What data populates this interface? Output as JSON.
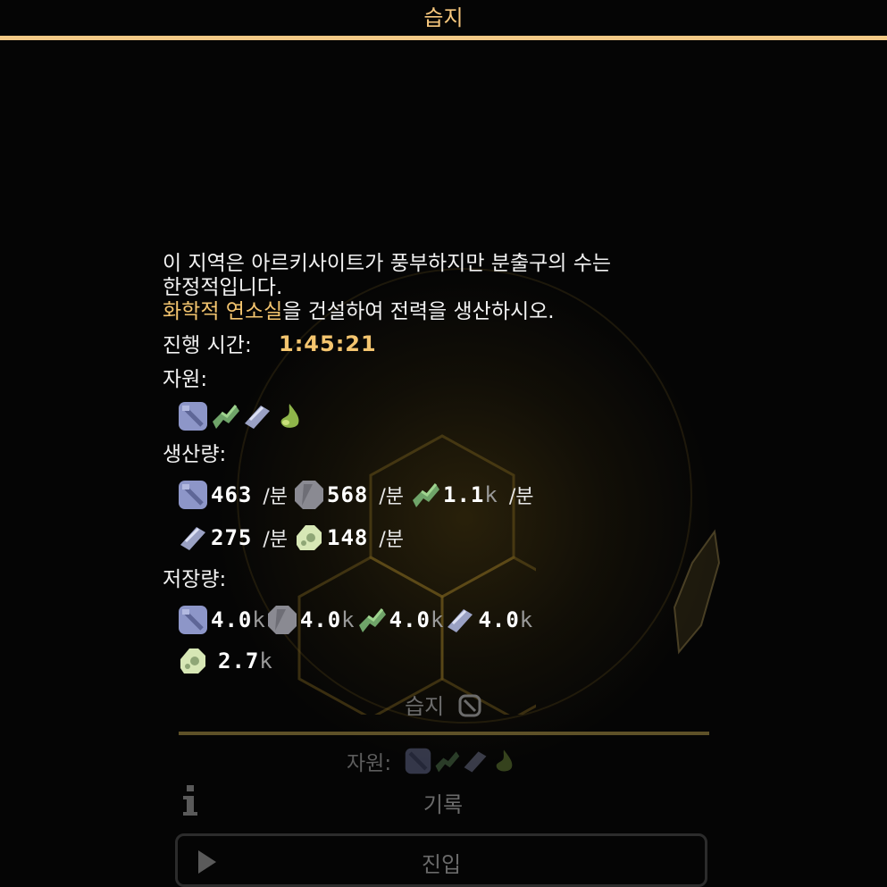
{
  "header": {
    "title": "습지"
  },
  "description": {
    "line1": "이 지역은 아르키사이트가 풍부하지만 분출구의 수는",
    "line2": "한정적입니다.",
    "highlight": "화학적 연소실",
    "rest": "을 건설하여 전력을 생산하시오."
  },
  "elapsed": {
    "label": "진행 시간:",
    "value": "1:45:21"
  },
  "resources": {
    "label": "자원:",
    "icons": [
      "beryllium-icon",
      "tungsten-icon",
      "graphite-icon",
      "arkycite-icon"
    ]
  },
  "production": {
    "label": "생산량:",
    "unit": "/분",
    "items": [
      {
        "icon": "beryllium-icon",
        "value": "463"
      },
      {
        "icon": "sand-icon",
        "value": "568"
      },
      {
        "icon": "tungsten-icon",
        "value": "1.1",
        "suffix": "k"
      },
      {
        "icon": "graphite-icon",
        "value": "275"
      },
      {
        "icon": "silicon-icon",
        "value": "148"
      }
    ]
  },
  "storage": {
    "label": "저장량:",
    "items": [
      {
        "icon": "beryllium-icon",
        "value": "4.0",
        "suffix": "k"
      },
      {
        "icon": "sand-icon",
        "value": "4.0",
        "suffix": "k"
      },
      {
        "icon": "tungsten-icon",
        "value": "4.0",
        "suffix": "k"
      },
      {
        "icon": "graphite-icon",
        "value": "4.0",
        "suffix": "k"
      },
      {
        "icon": "silicon-icon",
        "value": "2.7",
        "suffix": "k"
      }
    ]
  },
  "sector_panel": {
    "title": "습지",
    "resources_label": "자원:",
    "info_label": "기록",
    "enter_label": "진입"
  },
  "colors": {
    "accent": "#f3c985",
    "highlight": "#f4c56f",
    "beryllium": "#8d96c8",
    "tungsten": "#6fa469",
    "graphite": "#9aa1c4",
    "silicon": "#d7e7b5",
    "sand": "#8a8a92",
    "arkycite": "#8fb54a"
  }
}
